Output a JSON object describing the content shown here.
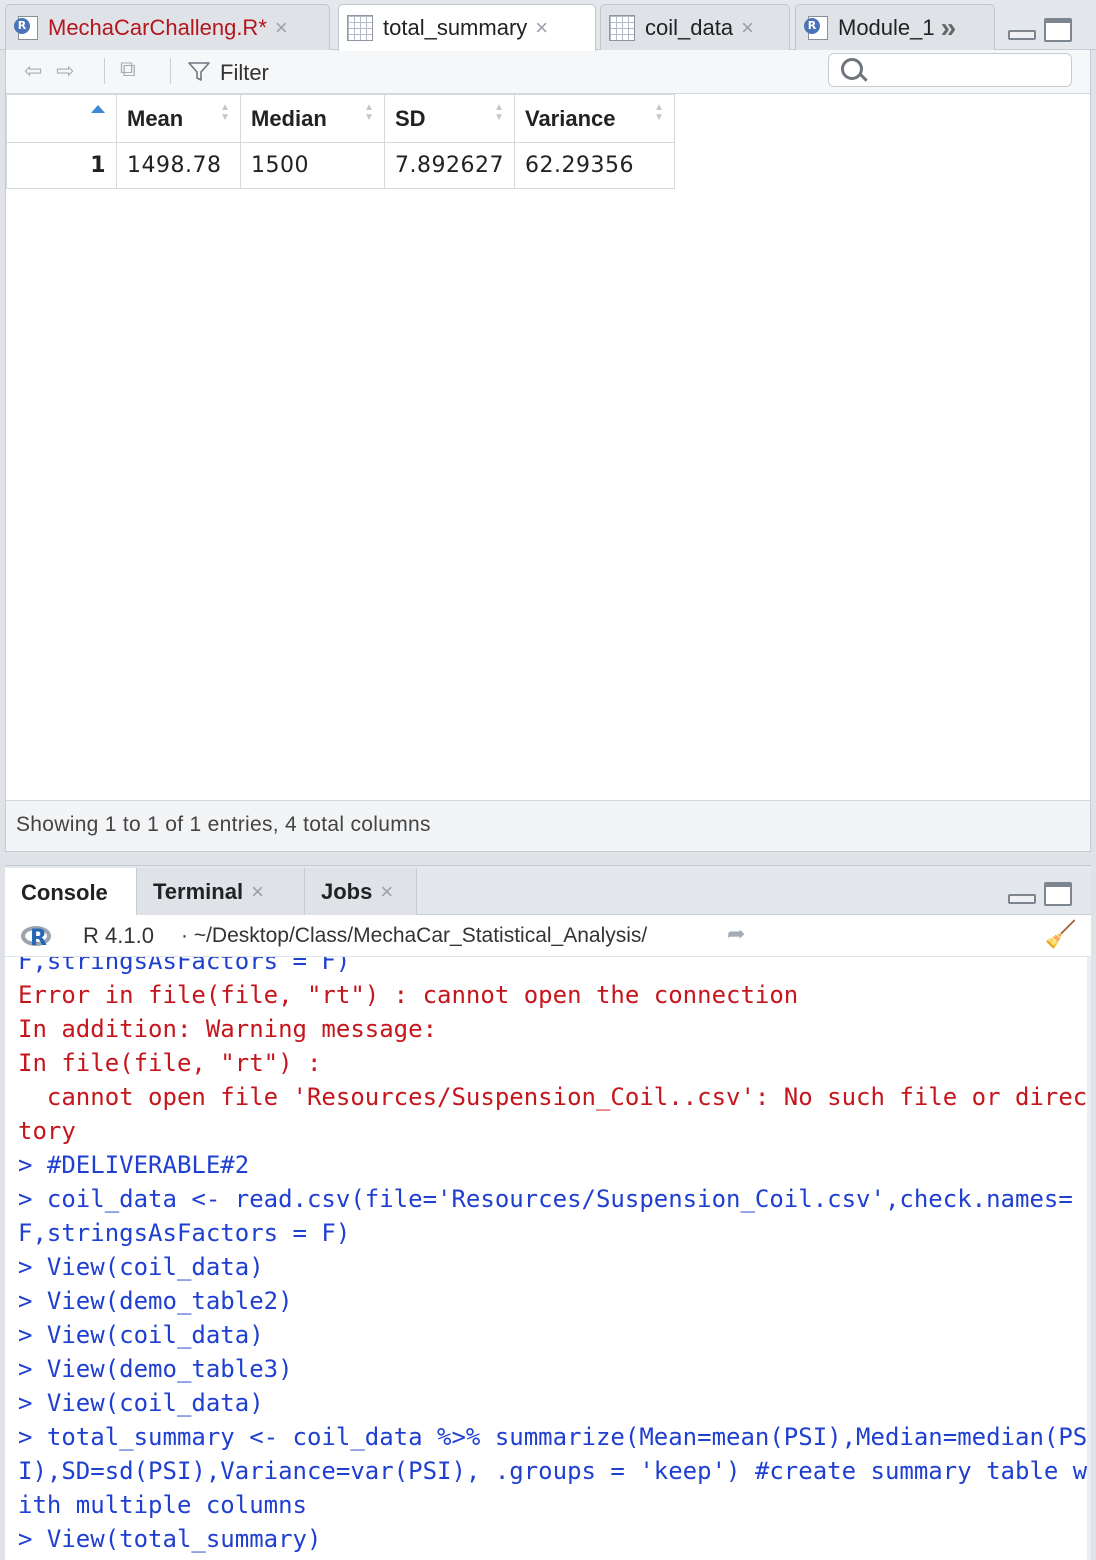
{
  "editor_tabs": [
    {
      "label": "MechaCarChalleng.R*",
      "icon": "r-script-icon",
      "color": "#b3161c"
    },
    {
      "label": "total_summary",
      "icon": "data-table-icon",
      "active": true
    },
    {
      "label": "coil_data",
      "icon": "data-table-icon"
    },
    {
      "label": "Module_1",
      "icon": "r-script-icon"
    }
  ],
  "tab_close_glyph": "×",
  "tab_overflow_glyph": "»",
  "viewer": {
    "filter_label": "Filter",
    "search_placeholder": "",
    "columns": [
      "",
      "Mean",
      "Median",
      "SD",
      "Variance"
    ],
    "rows": [
      {
        "rownum": "1",
        "mean": "1498.78",
        "median": "1500",
        "sd": "7.892627",
        "variance": "62.29356"
      }
    ],
    "status": "Showing 1 to 1 of 1 entries, 4 total columns"
  },
  "console_tabs": [
    {
      "label": "Console",
      "active": true
    },
    {
      "label": "Terminal"
    },
    {
      "label": "Jobs"
    }
  ],
  "console_header": {
    "r_version": "R 4.1.0",
    "path": " · ~/Desktop/Class/MechaCar_Statistical_Analysis/"
  },
  "console_lines": [
    {
      "text": "F,stringsAsFactors = F)",
      "kind": "cmd"
    },
    {
      "text": "Error in file(file, \"rt\") : cannot open the connection",
      "kind": "err"
    },
    {
      "text": "In addition: Warning message:",
      "kind": "err"
    },
    {
      "text": "In file(file, \"rt\") :",
      "kind": "err"
    },
    {
      "text": "  cannot open file 'Resources/Suspension_Coil..csv': No such file or direc",
      "kind": "err"
    },
    {
      "text": "tory",
      "kind": "err"
    },
    {
      "text": "> #DELIVERABLE#2",
      "kind": "cmd"
    },
    {
      "text": "> coil_data <- read.csv(file='Resources/Suspension_Coil.csv',check.names=",
      "kind": "cmd"
    },
    {
      "text": "F,stringsAsFactors = F)",
      "kind": "cmd"
    },
    {
      "text": "> View(coil_data)",
      "kind": "cmd"
    },
    {
      "text": "> View(demo_table2)",
      "kind": "cmd"
    },
    {
      "text": "> View(coil_data)",
      "kind": "cmd"
    },
    {
      "text": "> View(demo_table3)",
      "kind": "cmd"
    },
    {
      "text": "> View(coil_data)",
      "kind": "cmd"
    },
    {
      "text": "> total_summary <- coil_data %>% summarize(Mean=mean(PSI),Median=median(PS",
      "kind": "cmd"
    },
    {
      "text": "I),SD=sd(PSI),Variance=var(PSI), .groups = 'keep') #create summary table w",
      "kind": "cmd"
    },
    {
      "text": "ith multiple columns",
      "kind": "cmd"
    },
    {
      "text": "> View(total_summary)",
      "kind": "cmd"
    }
  ],
  "colors": {
    "error": "#c4161c",
    "command": "#1f3fd1",
    "sort_active": "#3b8ad8"
  }
}
